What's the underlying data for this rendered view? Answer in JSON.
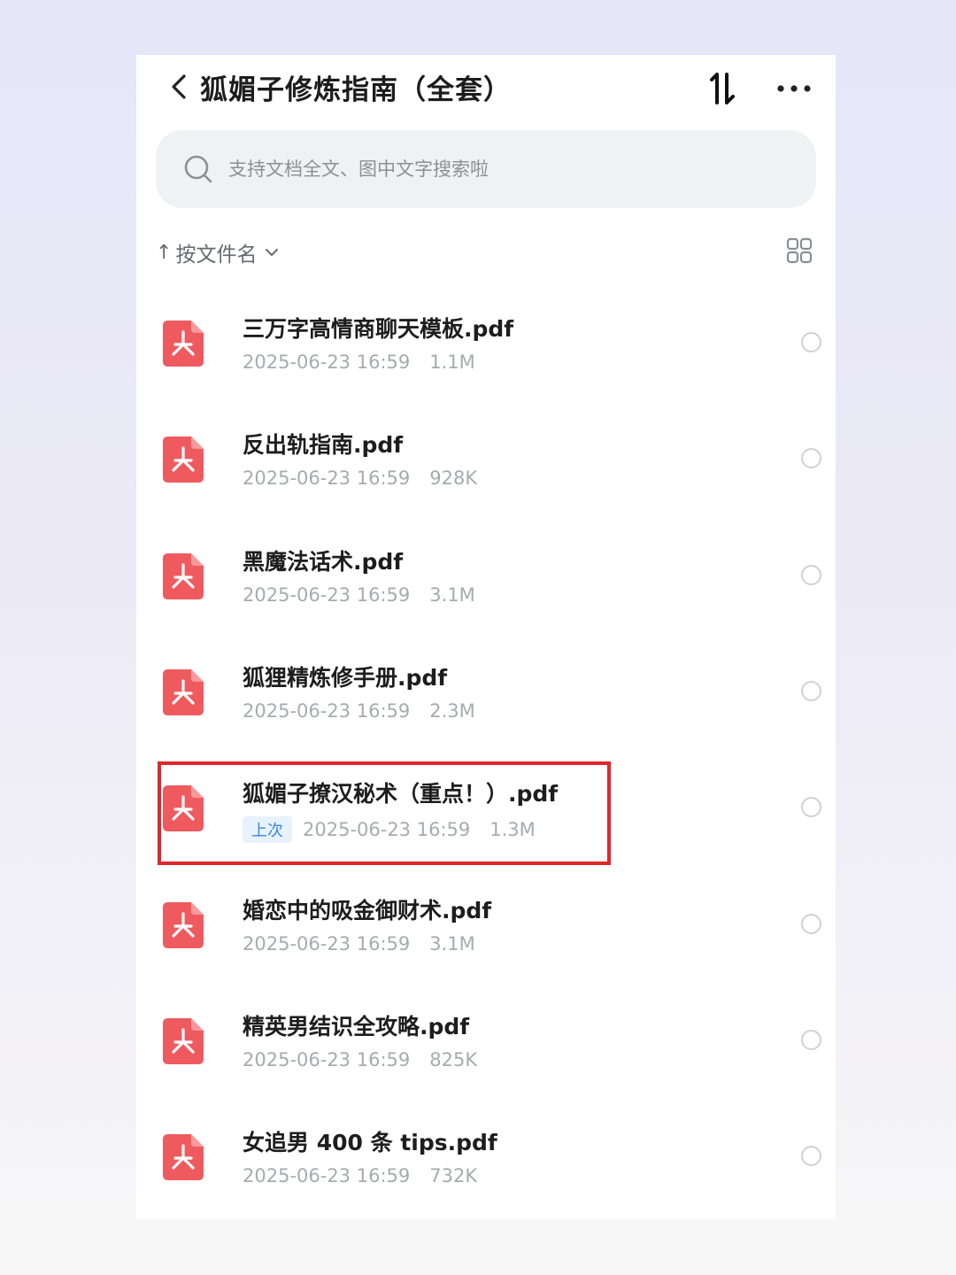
{
  "header": {
    "title": "狐媚子修炼指南（全套）",
    "back_icon": "chevron-left-icon",
    "sort_icon": "sort-toggle-icon",
    "more_icon": "more-dots-icon"
  },
  "search": {
    "placeholder": "支持文档全文、图中文字搜索啦",
    "value": ""
  },
  "sort": {
    "arrow": "↑",
    "label": "按文件名"
  },
  "colors": {
    "pdf_icon": "#ef5a5f",
    "highlight_border": "#e0272c",
    "last_tag_text": "#3a86e8",
    "last_tag_bg": "#e8f2fd"
  },
  "files": [
    {
      "name": "三万字高情商聊天模板.pdf",
      "date": "2025-06-23 16:59",
      "size": "1.1M",
      "tag": ""
    },
    {
      "name": "反出轨指南.pdf",
      "date": "2025-06-23 16:59",
      "size": "928K",
      "tag": ""
    },
    {
      "name": "黑魔法话术.pdf",
      "date": "2025-06-23 16:59",
      "size": "3.1M",
      "tag": ""
    },
    {
      "name": "狐狸精炼修手册.pdf",
      "date": "2025-06-23 16:59",
      "size": "2.3M",
      "tag": ""
    },
    {
      "name": "狐媚子撩汉秘术（重点！）.pdf",
      "date": "2025-06-23 16:59",
      "size": "1.3M",
      "tag": "上次"
    },
    {
      "name": "婚恋中的吸金御财术.pdf",
      "date": "2025-06-23 16:59",
      "size": "3.1M",
      "tag": ""
    },
    {
      "name": "精英男结识全攻略.pdf",
      "date": "2025-06-23 16:59",
      "size": "825K",
      "tag": ""
    },
    {
      "name": "女追男 400 条 tips.pdf",
      "date": "2025-06-23 16:59",
      "size": "732K",
      "tag": ""
    }
  ]
}
